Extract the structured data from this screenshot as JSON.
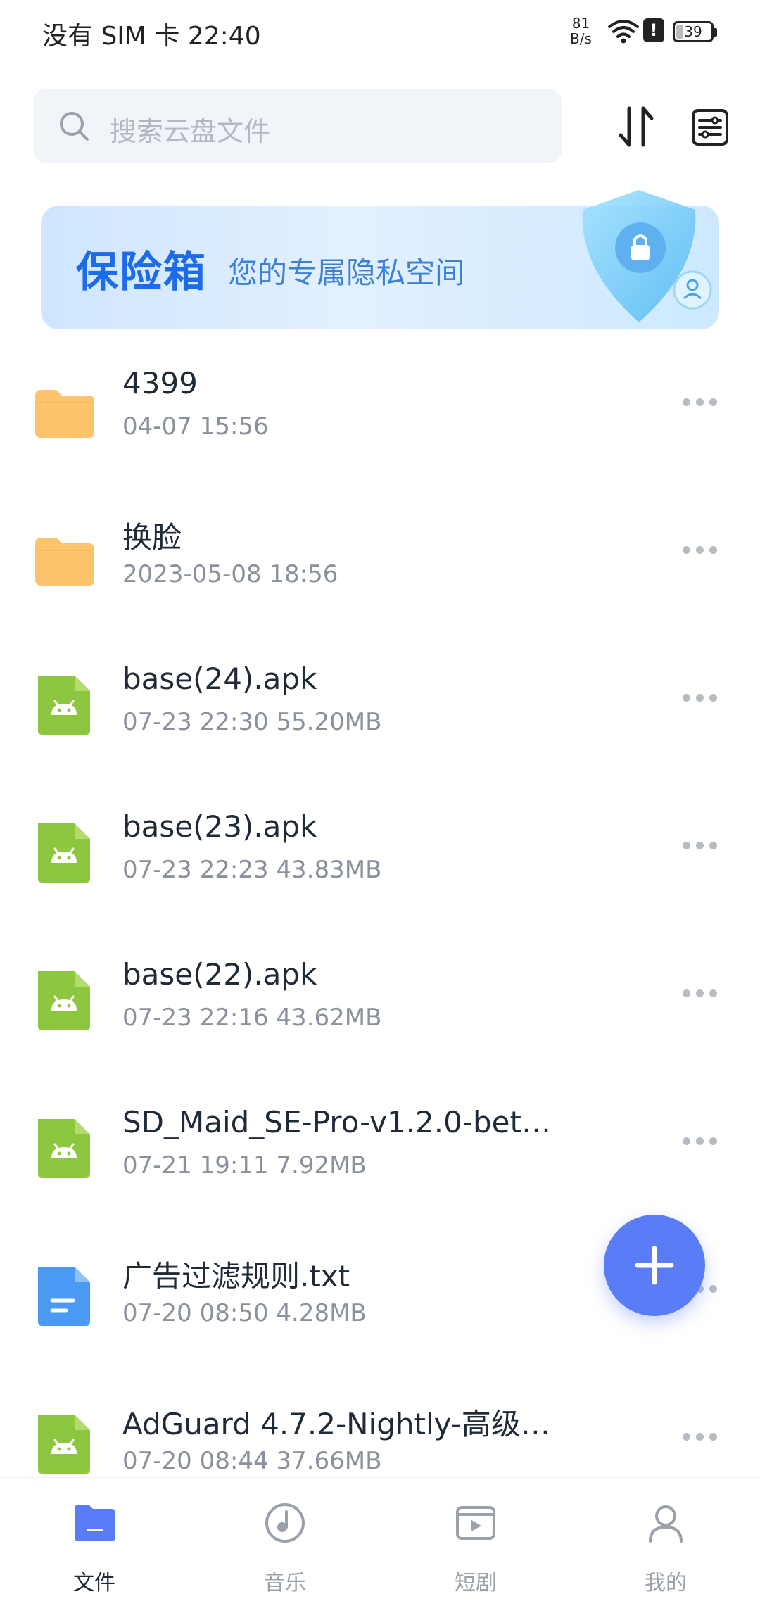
{
  "status_bar": {
    "carrier_time": "没有 SIM 卡 22:40",
    "net_speed_value": "81",
    "net_speed_unit": "B/s",
    "alert": "!",
    "battery": "39"
  },
  "search": {
    "placeholder": "搜索云盘文件"
  },
  "banner": {
    "title": "保险箱",
    "subtitle": "您的专属隐私空间"
  },
  "files": [
    {
      "name": "4399",
      "meta": "04-07 15:56",
      "type": "folder-icon"
    },
    {
      "name": "换脸",
      "meta": "2023-05-08 18:56",
      "type": "folder-icon"
    },
    {
      "name": "base(24).apk",
      "meta": "07-23 22:30  55.20MB",
      "type": "apk-file-icon"
    },
    {
      "name": "base(23).apk",
      "meta": "07-23 22:23  43.83MB",
      "type": "apk-file-icon"
    },
    {
      "name": "base(22).apk",
      "meta": "07-23 22:16  43.62MB",
      "type": "apk-file-icon"
    },
    {
      "name": "SD_Maid_SE-Pro-v1.2.0-bet…",
      "meta": "07-21 19:11  7.92MB",
      "type": "apk-file-icon"
    },
    {
      "name": "广告过滤规则.txt",
      "meta": "07-20 08:50  4.28MB",
      "type": "text-file-icon"
    },
    {
      "name": "AdGuard 4.7.2-Nightly-高级…",
      "meta": "07-20 08:44  37.66MB",
      "type": "apk-file-icon"
    }
  ],
  "nav": {
    "files": "文件",
    "music": "音乐",
    "shorts": "短剧",
    "me": "我的"
  },
  "colors": {
    "accent": "#5b7cf7",
    "folder": "#fcc46c",
    "apk": "#8dc63f",
    "txt": "#4a9af5"
  }
}
